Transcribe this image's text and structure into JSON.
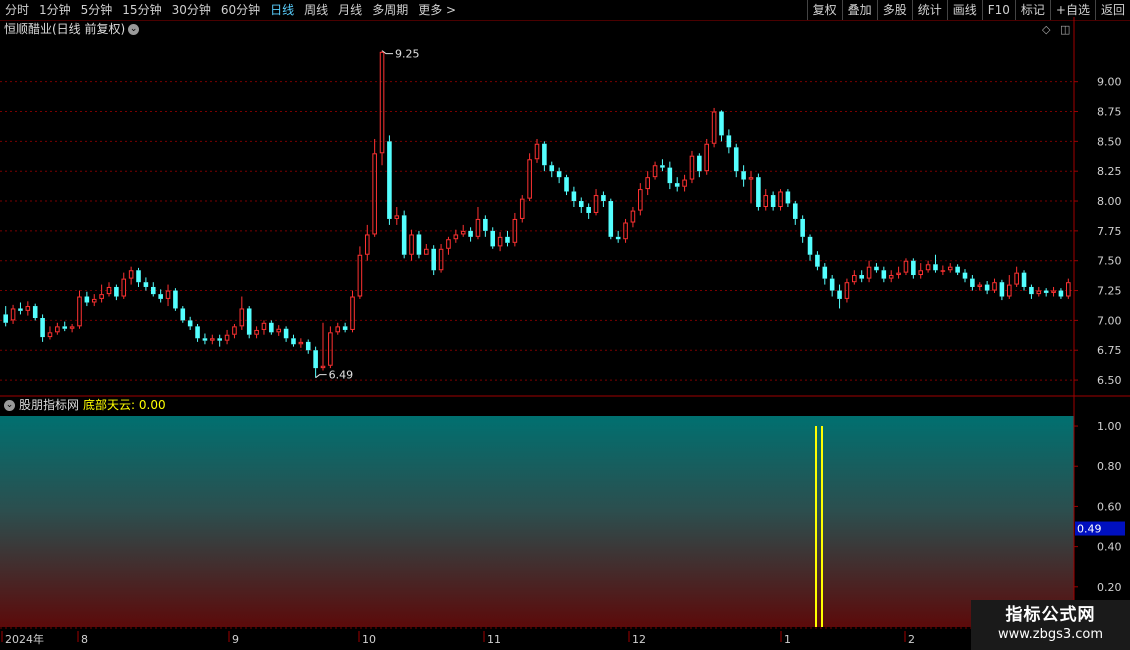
{
  "toolbar": {
    "left": [
      "分时",
      "1分钟",
      "5分钟",
      "15分钟",
      "30分钟",
      "60分钟",
      "日线",
      "周线",
      "月线",
      "多周期",
      "更多 >"
    ],
    "active": "日线",
    "right": [
      "复权",
      "叠加",
      "多股",
      "统计",
      "画线",
      "F10",
      "标记",
      "+自选",
      "返回"
    ]
  },
  "main_chart": {
    "stock_title": "恒顺醋业(日线 前复权)",
    "high_label": "9.25",
    "low_label": "6.49"
  },
  "indicator": {
    "source_name": "股朋指标网",
    "line_label": "底部天云: 0.00",
    "current_value": "0.49"
  },
  "colors": {
    "up": "#ff3232",
    "down": "#54ffff",
    "grid": "#7a0000",
    "signal": "#ffff00"
  },
  "watermark": {
    "line1": "指标公式网",
    "line2": "www.zbgs3.com"
  },
  "chart_data": [
    {
      "type": "candlestick",
      "title": "恒顺醋业(日线 前复权)",
      "ylim": [
        6.4,
        9.5
      ],
      "y_ticks": [
        "9.00",
        "8.75",
        "8.50",
        "8.25",
        "8.00",
        "7.75",
        "7.50",
        "7.25",
        "7.00",
        "6.75",
        "6.50"
      ],
      "x_labels": [
        "2024年",
        "8",
        "9",
        "10",
        "11",
        "12",
        "1",
        "2"
      ],
      "annotations": [
        {
          "text": "9.25"
        },
        {
          "text": "6.49"
        }
      ],
      "candles": [
        [
          7.05,
          6.98,
          7.12,
          6.95
        ],
        [
          7.0,
          7.1,
          7.13,
          6.97
        ],
        [
          7.1,
          7.08,
          7.15,
          7.05
        ],
        [
          7.08,
          7.12,
          7.16,
          7.04
        ],
        [
          7.12,
          7.02,
          7.14,
          7.0
        ],
        [
          7.02,
          6.86,
          7.05,
          6.82
        ],
        [
          6.86,
          6.9,
          6.95,
          6.84
        ],
        [
          6.9,
          6.95,
          6.98,
          6.88
        ],
        [
          6.95,
          6.93,
          6.99,
          6.91
        ],
        [
          6.93,
          6.95,
          6.97,
          6.9
        ],
        [
          6.95,
          7.2,
          7.25,
          6.93
        ],
        [
          7.2,
          7.15,
          7.24,
          7.12
        ],
        [
          7.15,
          7.18,
          7.22,
          7.12
        ],
        [
          7.18,
          7.22,
          7.3,
          7.15
        ],
        [
          7.22,
          7.28,
          7.32,
          7.2
        ],
        [
          7.28,
          7.2,
          7.3,
          7.17
        ],
        [
          7.2,
          7.35,
          7.4,
          7.18
        ],
        [
          7.35,
          7.42,
          7.45,
          7.3
        ],
        [
          7.42,
          7.32,
          7.44,
          7.28
        ],
        [
          7.32,
          7.28,
          7.36,
          7.25
        ],
        [
          7.28,
          7.22,
          7.32,
          7.2
        ],
        [
          7.22,
          7.18,
          7.26,
          7.15
        ],
        [
          7.18,
          7.25,
          7.3,
          7.12
        ],
        [
          7.25,
          7.1,
          7.27,
          7.08
        ],
        [
          7.1,
          7.0,
          7.12,
          6.98
        ],
        [
          7.0,
          6.95,
          7.03,
          6.92
        ],
        [
          6.95,
          6.85,
          6.97,
          6.82
        ],
        [
          6.85,
          6.83,
          6.89,
          6.8
        ],
        [
          6.83,
          6.85,
          6.88,
          6.8
        ],
        [
          6.85,
          6.83,
          6.88,
          6.78
        ],
        [
          6.83,
          6.88,
          6.92,
          6.8
        ],
        [
          6.88,
          6.95,
          6.97,
          6.85
        ],
        [
          6.95,
          7.1,
          7.2,
          6.92
        ],
        [
          7.1,
          6.88,
          7.12,
          6.85
        ],
        [
          6.88,
          6.92,
          6.95,
          6.85
        ],
        [
          6.92,
          6.98,
          7.0,
          6.88
        ],
        [
          6.98,
          6.9,
          7.0,
          6.88
        ],
        [
          6.9,
          6.93,
          6.96,
          6.87
        ],
        [
          6.93,
          6.85,
          6.95,
          6.82
        ],
        [
          6.85,
          6.8,
          6.88,
          6.78
        ],
        [
          6.8,
          6.82,
          6.85,
          6.77
        ],
        [
          6.82,
          6.75,
          6.84,
          6.72
        ],
        [
          6.75,
          6.6,
          6.78,
          6.52
        ],
        [
          6.6,
          6.62,
          6.98,
          6.58
        ],
        [
          6.62,
          6.9,
          6.95,
          6.6
        ],
        [
          6.9,
          6.95,
          6.98,
          6.88
        ],
        [
          6.95,
          6.92,
          6.98,
          6.9
        ],
        [
          6.92,
          7.2,
          7.25,
          6.9
        ],
        [
          7.2,
          7.55,
          7.62,
          7.18
        ],
        [
          7.55,
          7.72,
          7.8,
          7.5
        ],
        [
          7.72,
          8.4,
          8.52,
          7.7
        ],
        [
          8.4,
          9.25,
          9.26,
          8.3
        ],
        [
          8.5,
          7.85,
          8.55,
          7.8
        ],
        [
          7.85,
          7.88,
          7.95,
          7.8
        ],
        [
          7.88,
          7.55,
          7.92,
          7.52
        ],
        [
          7.55,
          7.72,
          7.76,
          7.5
        ],
        [
          7.72,
          7.55,
          7.75,
          7.52
        ],
        [
          7.55,
          7.6,
          7.64,
          7.55
        ],
        [
          7.6,
          7.42,
          7.63,
          7.38
        ],
        [
          7.42,
          7.6,
          7.64,
          7.4
        ],
        [
          7.6,
          7.68,
          7.7,
          7.55
        ],
        [
          7.68,
          7.72,
          7.76,
          7.65
        ],
        [
          7.72,
          7.75,
          7.8,
          7.7
        ],
        [
          7.75,
          7.7,
          7.78,
          7.66
        ],
        [
          7.7,
          7.85,
          7.95,
          7.68
        ],
        [
          7.85,
          7.75,
          7.88,
          7.7
        ],
        [
          7.75,
          7.62,
          7.78,
          7.6
        ],
        [
          7.62,
          7.7,
          7.74,
          7.58
        ],
        [
          7.7,
          7.65,
          7.75,
          7.62
        ],
        [
          7.65,
          7.85,
          7.9,
          7.62
        ],
        [
          7.85,
          8.02,
          8.05,
          7.82
        ],
        [
          8.02,
          8.35,
          8.4,
          8.0
        ],
        [
          8.35,
          8.48,
          8.52,
          8.32
        ],
        [
          8.48,
          8.3,
          8.5,
          8.25
        ],
        [
          8.3,
          8.25,
          8.33,
          8.2
        ],
        [
          8.25,
          8.2,
          8.28,
          8.15
        ],
        [
          8.2,
          8.08,
          8.22,
          8.05
        ],
        [
          8.08,
          8.0,
          8.12,
          7.95
        ],
        [
          8.0,
          7.95,
          8.03,
          7.9
        ],
        [
          7.95,
          7.9,
          7.98,
          7.85
        ],
        [
          7.9,
          8.05,
          8.1,
          7.88
        ],
        [
          8.05,
          8.0,
          8.08,
          7.95
        ],
        [
          8.0,
          7.7,
          8.02,
          7.68
        ],
        [
          7.7,
          7.68,
          7.75,
          7.65
        ],
        [
          7.68,
          7.82,
          7.85,
          7.65
        ],
        [
          7.82,
          7.92,
          7.95,
          7.78
        ],
        [
          7.92,
          8.1,
          8.15,
          7.88
        ],
        [
          8.1,
          8.2,
          8.25,
          8.05
        ],
        [
          8.2,
          8.3,
          8.33,
          8.18
        ],
        [
          8.3,
          8.28,
          8.35,
          8.25
        ],
        [
          8.28,
          8.15,
          8.33,
          8.1
        ],
        [
          8.15,
          8.12,
          8.2,
          8.08
        ],
        [
          8.12,
          8.18,
          8.22,
          8.08
        ],
        [
          8.18,
          8.38,
          8.42,
          8.15
        ],
        [
          8.38,
          8.25,
          8.4,
          8.2
        ],
        [
          8.25,
          8.48,
          8.52,
          8.22
        ],
        [
          8.48,
          8.75,
          8.78,
          8.45
        ],
        [
          8.75,
          8.55,
          8.76,
          8.5
        ],
        [
          8.55,
          8.45,
          8.6,
          8.4
        ],
        [
          8.45,
          8.25,
          8.48,
          8.2
        ],
        [
          8.25,
          8.18,
          8.3,
          8.12
        ],
        [
          8.18,
          8.2,
          8.25,
          7.98
        ],
        [
          8.2,
          7.95,
          8.23,
          7.92
        ],
        [
          7.95,
          8.05,
          8.1,
          7.92
        ],
        [
          8.05,
          7.95,
          8.08,
          7.92
        ],
        [
          7.95,
          8.08,
          8.1,
          7.92
        ],
        [
          8.08,
          7.98,
          8.1,
          7.95
        ],
        [
          7.98,
          7.85,
          8.0,
          7.8
        ],
        [
          7.85,
          7.7,
          7.88,
          7.65
        ],
        [
          7.7,
          7.55,
          7.72,
          7.5
        ],
        [
          7.55,
          7.45,
          7.58,
          7.42
        ],
        [
          7.45,
          7.35,
          7.48,
          7.3
        ],
        [
          7.35,
          7.25,
          7.38,
          7.2
        ],
        [
          7.25,
          7.18,
          7.3,
          7.1
        ],
        [
          7.18,
          7.32,
          7.35,
          7.15
        ],
        [
          7.32,
          7.38,
          7.42,
          7.3
        ],
        [
          7.38,
          7.35,
          7.42,
          7.32
        ],
        [
          7.35,
          7.45,
          7.5,
          7.32
        ],
        [
          7.45,
          7.42,
          7.48,
          7.4
        ],
        [
          7.42,
          7.35,
          7.45,
          7.32
        ],
        [
          7.35,
          7.38,
          7.42,
          7.32
        ],
        [
          7.38,
          7.4,
          7.45,
          7.35
        ],
        [
          7.4,
          7.5,
          7.52,
          7.38
        ],
        [
          7.5,
          7.38,
          7.52,
          7.35
        ],
        [
          7.38,
          7.42,
          7.48,
          7.35
        ],
        [
          7.42,
          7.47,
          7.5,
          7.4
        ],
        [
          7.47,
          7.42,
          7.55,
          7.4
        ],
        [
          7.42,
          7.42,
          7.46,
          7.38
        ],
        [
          7.42,
          7.45,
          7.48,
          7.4
        ],
        [
          7.45,
          7.4,
          7.47,
          7.38
        ],
        [
          7.4,
          7.35,
          7.43,
          7.32
        ],
        [
          7.35,
          7.28,
          7.38,
          7.25
        ],
        [
          7.28,
          7.3,
          7.32,
          7.25
        ],
        [
          7.3,
          7.25,
          7.33,
          7.22
        ],
        [
          7.25,
          7.32,
          7.35,
          7.23
        ],
        [
          7.32,
          7.2,
          7.34,
          7.17
        ],
        [
          7.2,
          7.3,
          7.38,
          7.18
        ],
        [
          7.3,
          7.4,
          7.45,
          7.28
        ],
        [
          7.4,
          7.28,
          7.42,
          7.25
        ],
        [
          7.28,
          7.22,
          7.3,
          7.18
        ],
        [
          7.22,
          7.25,
          7.28,
          7.2
        ],
        [
          7.25,
          7.23,
          7.27,
          7.2
        ],
        [
          7.23,
          7.25,
          7.28,
          7.2
        ],
        [
          7.25,
          7.2,
          7.27,
          7.18
        ],
        [
          7.2,
          7.32,
          7.35,
          7.18
        ]
      ]
    },
    {
      "type": "bar",
      "title": "底部天云",
      "ylim": [
        0,
        1.05
      ],
      "y_ticks": [
        "1.00",
        "0.80",
        "0.60",
        "0.40",
        "0.20"
      ],
      "signals": [
        {
          "value": 1.0
        },
        {
          "value": 1.0
        }
      ]
    }
  ]
}
